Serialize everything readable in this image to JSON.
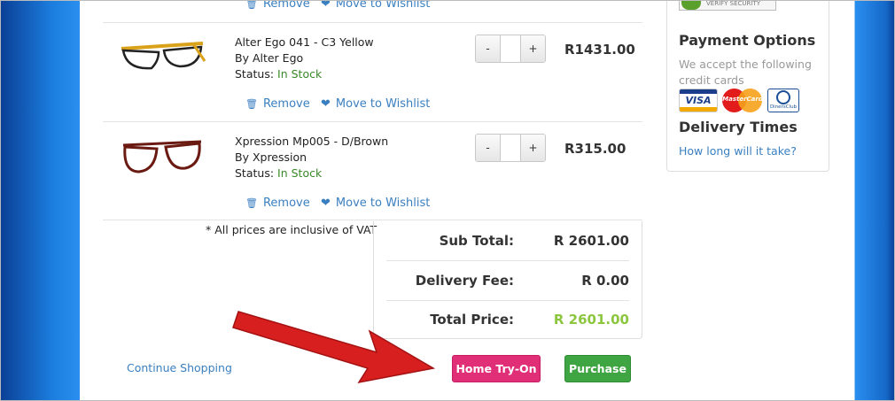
{
  "cart": {
    "top_actions": {
      "remove": "Remove",
      "wishlist": "Move to Wishlist"
    },
    "items": [
      {
        "name": "Alter Ego 041 - C3 Yellow",
        "brand": "By Alter Ego",
        "status_label": "Status: ",
        "status": "In Stock",
        "qty_minus": "-",
        "qty_value": "",
        "qty_plus": "+",
        "price": "R1431.00",
        "remove": "Remove",
        "wishlist": "Move to Wishlist"
      },
      {
        "name": "Xpression Mp005 - D/Brown",
        "brand": "By Xpression",
        "status_label": "Status: ",
        "status": "In Stock",
        "qty_minus": "-",
        "qty_value": "",
        "qty_plus": "+",
        "price": "R315.00",
        "remove": "Remove",
        "wishlist": "Move to Wishlist"
      }
    ],
    "vat_note": "* All prices are inclusive of VAT",
    "totals": {
      "sub_total_label": "Sub Total:",
      "sub_total": "R 2601.00",
      "delivery_label": "Delivery Fee:",
      "delivery": "R 0.00",
      "total_label": "Total Price:",
      "total": "R 2601.00",
      "total_color": "#8cc63f"
    },
    "continue_shopping": "Continue Shopping",
    "home_try_on": "Home Try-On",
    "purchase": "Purchase"
  },
  "sidebar": {
    "security_badge": "VERIFY SECURITY",
    "payment_title": "Payment Options",
    "payment_text": "We accept the following credit cards",
    "cards": [
      "VISA",
      "MasterCard",
      "DinersClub"
    ],
    "delivery_title": "Delivery Times",
    "delivery_link": "How long will it take?"
  },
  "colors": {
    "link": "#3a7fc0",
    "home_try_on_bg": "#e02e77",
    "purchase_bg": "#3fa442",
    "arrow": "#d81f1f"
  }
}
